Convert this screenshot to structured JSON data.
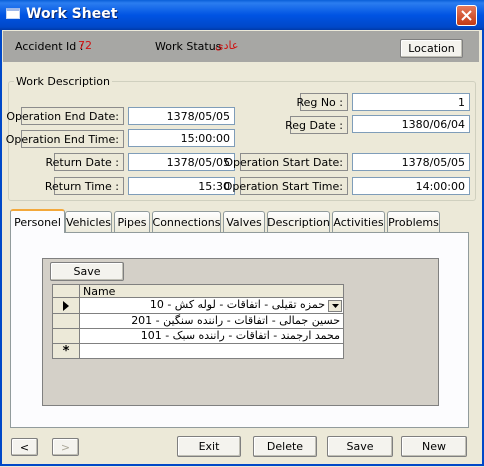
{
  "window": {
    "title": "Work Sheet"
  },
  "header": {
    "accident_label": "Accident Id :",
    "accident_value": "72",
    "status_label": "Work Status",
    "status_value": "عادی",
    "location_button": "Location"
  },
  "work_description": {
    "title": "Work Description",
    "operation_end_date_label": "Operation End Date:",
    "operation_end_date": "1378/05/05",
    "operation_end_time_label": "Operation End Time:",
    "operation_end_time": "15:00:00",
    "return_date_label": "Return Date :",
    "return_date": "1378/05/05",
    "return_time_label": "Return Time :",
    "return_time": "15:30",
    "reg_no_label": "Reg No :",
    "reg_no": "1",
    "reg_date_label": "Reg Date :",
    "reg_date": "1380/06/04",
    "operation_start_date_label": "Operation Start Date:",
    "operation_start_date": "1378/05/05",
    "operation_start_time_label": "Operation Start Time:",
    "operation_start_time": "14:00:00"
  },
  "tabs": [
    "Personel",
    "Vehicles",
    "Pipes",
    "Connections",
    "Valves",
    "Description",
    "Activities",
    "Problems"
  ],
  "subform": {
    "save_button": "Save",
    "column_header": "Name",
    "rows": [
      "حمزه تقیلی - اتفاقات - لوله کش - 10",
      "حسین جمالی - اتفاقات - راننده سنگین - 201",
      "محمد ارجمند - اتفاقات - راننده سبک - 101"
    ],
    "new_row_marker": "*"
  },
  "navigation": {
    "prev": "<",
    "next": ">"
  },
  "buttons": {
    "exit": "Exit",
    "delete": "Delete",
    "save": "Save",
    "new": "New"
  },
  "colors": {
    "titlebar": "#0054e3",
    "header_strip": "#a7a7a4",
    "value_text": "#d01010",
    "active_tab_border": "#f3a83b"
  }
}
